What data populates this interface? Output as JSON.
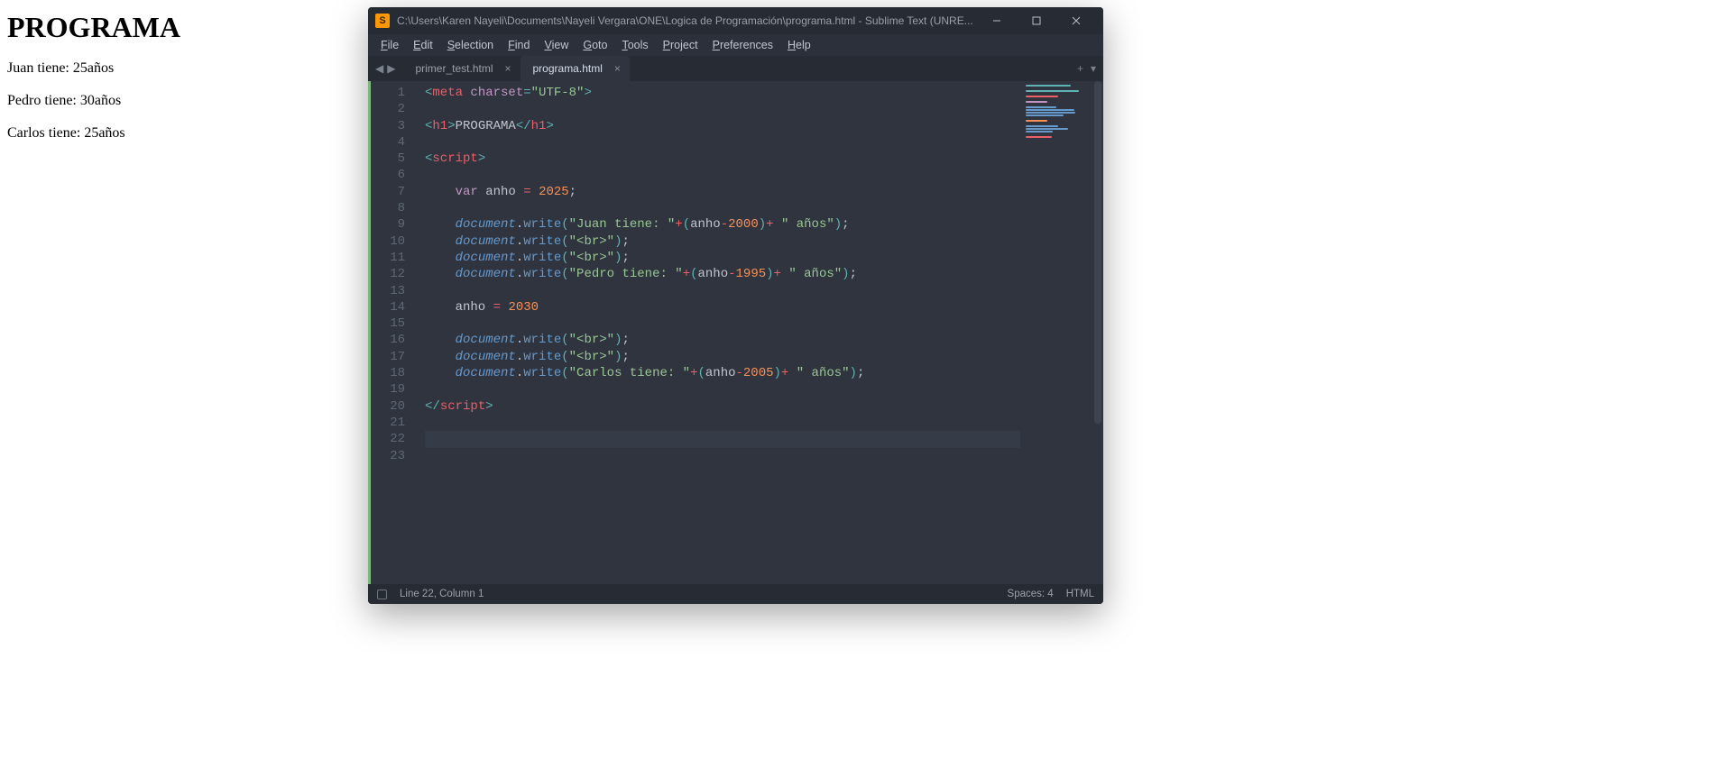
{
  "page_output": {
    "heading": "PROGRAMA",
    "lines": [
      "Juan tiene: 25años",
      "Pedro tiene: 30años",
      "Carlos tiene: 25años"
    ]
  },
  "titlebar": {
    "app_icon_letter": "S",
    "title": "C:\\Users\\Karen Nayeli\\Documents\\Nayeli Vergara\\ONE\\Logica de Programación\\programa.html - Sublime Text (UNRE..."
  },
  "menu": {
    "items": [
      "File",
      "Edit",
      "Selection",
      "Find",
      "View",
      "Goto",
      "Tools",
      "Project",
      "Preferences",
      "Help"
    ]
  },
  "tabs": {
    "nav_back": "◀",
    "nav_fwd": "▶",
    "list": [
      {
        "label": "primer_test.html",
        "active": false
      },
      {
        "label": "programa.html",
        "active": true
      }
    ],
    "add": "+",
    "menu": "▾"
  },
  "editor": {
    "line_numbers": [
      "1",
      "2",
      "3",
      "4",
      "5",
      "6",
      "7",
      "8",
      "9",
      "10",
      "11",
      "12",
      "13",
      "14",
      "15",
      "16",
      "17",
      "18",
      "19",
      "20",
      "21",
      "22",
      "23"
    ],
    "code_lines": [
      [
        [
          "p",
          "<"
        ],
        [
          "tag",
          "meta"
        ],
        [
          "id",
          " "
        ],
        [
          "attr",
          "charset"
        ],
        [
          "p",
          "="
        ],
        [
          "str",
          "\"UTF-8\""
        ],
        [
          "p",
          ">"
        ]
      ],
      [],
      [
        [
          "p",
          "<"
        ],
        [
          "tag",
          "h1"
        ],
        [
          "p",
          ">"
        ],
        [
          "id",
          "PROGRAMA"
        ],
        [
          "p",
          "</"
        ],
        [
          "tag",
          "h1"
        ],
        [
          "p",
          ">"
        ]
      ],
      [],
      [
        [
          "p",
          "<"
        ],
        [
          "tag",
          "script"
        ],
        [
          "p",
          ">"
        ]
      ],
      [],
      [
        [
          "id",
          "    "
        ],
        [
          "kw",
          "var"
        ],
        [
          "id",
          " anho "
        ],
        [
          "op",
          "="
        ],
        [
          "id",
          " "
        ],
        [
          "num",
          "2025"
        ],
        [
          "id",
          ";"
        ]
      ],
      [],
      [
        [
          "id",
          "    "
        ],
        [
          "obj",
          "document"
        ],
        [
          "id",
          "."
        ],
        [
          "fn",
          "write"
        ],
        [
          "p",
          "("
        ],
        [
          "str",
          "\"Juan tiene: \""
        ],
        [
          "op",
          "+"
        ],
        [
          "p",
          "("
        ],
        [
          "id",
          "anho"
        ],
        [
          "op",
          "-"
        ],
        [
          "num",
          "2000"
        ],
        [
          "p",
          ")"
        ],
        [
          "op",
          "+"
        ],
        [
          "id",
          " "
        ],
        [
          "str",
          "\" años\""
        ],
        [
          "p",
          ")"
        ],
        [
          "id",
          ";"
        ]
      ],
      [
        [
          "id",
          "    "
        ],
        [
          "obj",
          "document"
        ],
        [
          "id",
          "."
        ],
        [
          "fn",
          "write"
        ],
        [
          "p",
          "("
        ],
        [
          "str",
          "\"<br>\""
        ],
        [
          "p",
          ")"
        ],
        [
          "id",
          ";"
        ]
      ],
      [
        [
          "id",
          "    "
        ],
        [
          "obj",
          "document"
        ],
        [
          "id",
          "."
        ],
        [
          "fn",
          "write"
        ],
        [
          "p",
          "("
        ],
        [
          "str",
          "\"<br>\""
        ],
        [
          "p",
          ")"
        ],
        [
          "id",
          ";"
        ]
      ],
      [
        [
          "id",
          "    "
        ],
        [
          "obj",
          "document"
        ],
        [
          "id",
          "."
        ],
        [
          "fn",
          "write"
        ],
        [
          "p",
          "("
        ],
        [
          "str",
          "\"Pedro tiene: \""
        ],
        [
          "op",
          "+"
        ],
        [
          "p",
          "("
        ],
        [
          "id",
          "anho"
        ],
        [
          "op",
          "-"
        ],
        [
          "num",
          "1995"
        ],
        [
          "p",
          ")"
        ],
        [
          "op",
          "+"
        ],
        [
          "id",
          " "
        ],
        [
          "str",
          "\" años\""
        ],
        [
          "p",
          ")"
        ],
        [
          "id",
          ";"
        ]
      ],
      [],
      [
        [
          "id",
          "    anho "
        ],
        [
          "op",
          "="
        ],
        [
          "id",
          " "
        ],
        [
          "num",
          "2030"
        ]
      ],
      [],
      [
        [
          "id",
          "    "
        ],
        [
          "obj",
          "document"
        ],
        [
          "id",
          "."
        ],
        [
          "fn",
          "write"
        ],
        [
          "p",
          "("
        ],
        [
          "str",
          "\"<br>\""
        ],
        [
          "p",
          ")"
        ],
        [
          "id",
          ";"
        ]
      ],
      [
        [
          "id",
          "    "
        ],
        [
          "obj",
          "document"
        ],
        [
          "id",
          "."
        ],
        [
          "fn",
          "write"
        ],
        [
          "p",
          "("
        ],
        [
          "str",
          "\"<br>\""
        ],
        [
          "p",
          ")"
        ],
        [
          "id",
          ";"
        ]
      ],
      [
        [
          "id",
          "    "
        ],
        [
          "obj",
          "document"
        ],
        [
          "id",
          "."
        ],
        [
          "fn",
          "write"
        ],
        [
          "p",
          "("
        ],
        [
          "str",
          "\"Carlos tiene: \""
        ],
        [
          "op",
          "+"
        ],
        [
          "p",
          "("
        ],
        [
          "id",
          "anho"
        ],
        [
          "op",
          "-"
        ],
        [
          "num",
          "2005"
        ],
        [
          "p",
          ")"
        ],
        [
          "op",
          "+"
        ],
        [
          "id",
          " "
        ],
        [
          "str",
          "\" años\""
        ],
        [
          "p",
          ")"
        ],
        [
          "id",
          ";"
        ]
      ],
      [],
      [
        [
          "p",
          "</"
        ],
        [
          "tag",
          "script"
        ],
        [
          "p",
          ">"
        ]
      ],
      [],
      [],
      []
    ],
    "cursor_line_index": 21
  },
  "statusbar": {
    "position": "Line 22, Column 1",
    "indent": "Spaces: 4",
    "syntax": "HTML"
  },
  "minimap_colors": [
    "#5fb3b3",
    "#2f343f",
    "#5fb3b3",
    "#2f343f",
    "#ec5f67",
    "#2f343f",
    "#c594c5",
    "#2f343f",
    "#6699cc",
    "#6699cc",
    "#6699cc",
    "#6699cc",
    "#2f343f",
    "#f99157",
    "#2f343f",
    "#6699cc",
    "#6699cc",
    "#6699cc",
    "#2f343f",
    "#ec5f67"
  ]
}
